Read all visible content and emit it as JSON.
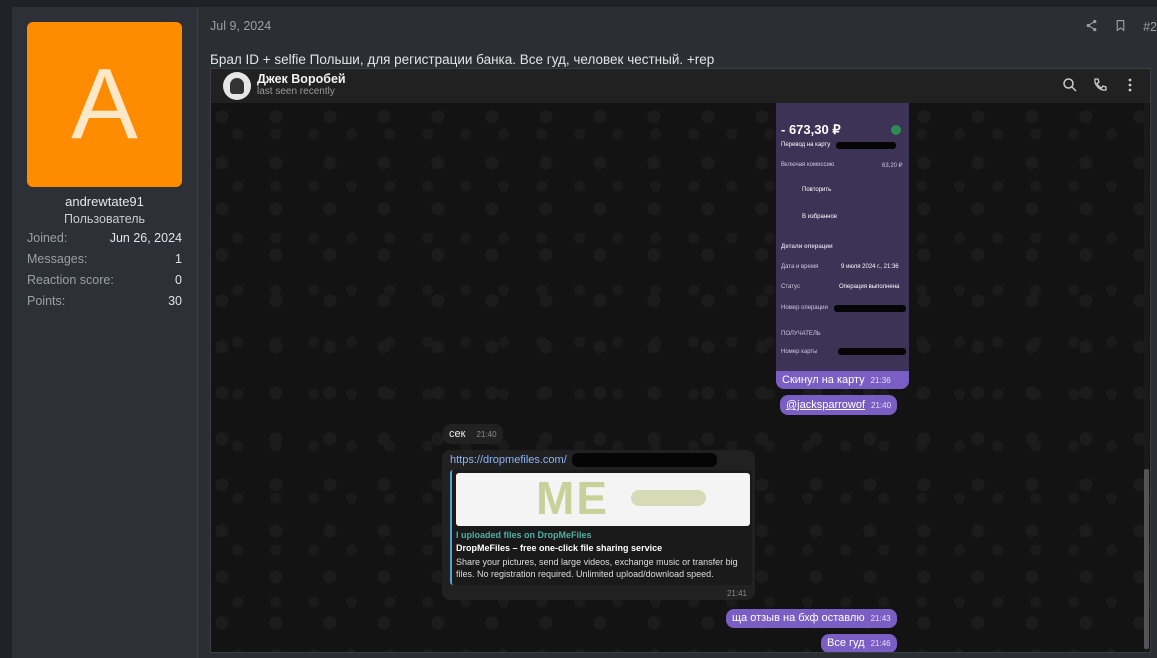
{
  "user": {
    "avatar_letter": "A",
    "username": "andrewtate91",
    "title": "Пользователь",
    "stats": [
      {
        "label": "Joined:",
        "value": "Jun 26, 2024"
      },
      {
        "label": "Messages:",
        "value": "1"
      },
      {
        "label": "Reaction score:",
        "value": "0"
      },
      {
        "label": "Points:",
        "value": "30"
      }
    ]
  },
  "post": {
    "date": "Jul 9, 2024",
    "number": "#2",
    "text": "Брал ID + selfie Польши, для регистрации банка. Все гуд, человек честный. +rep"
  },
  "telegram": {
    "contact_name": "Джек Воробей",
    "contact_status": "last seen recently",
    "bank": {
      "amount": "- 673,30 ₽",
      "transfer_label": "Перевод на карту",
      "fee_label": "Включая комиссию",
      "fee_value": "63,20 ₽",
      "repeat": "Повторить",
      "favorite": "В избранное",
      "details_title": "Детали операции",
      "date_label": "Дата и время",
      "date_value": "9 июля 2024 г., 21:36",
      "status_label": "Статус",
      "status_value": "Операция выполнена",
      "opnum_label": "Номер операции",
      "recipient_label": "ПОЛУЧАТЕЛЬ",
      "card_label": "Номер карты"
    },
    "messages": [
      {
        "text": "Скинул на карту",
        "time": "21:36"
      },
      {
        "text": "@jacksparrowof",
        "time": "21:40"
      },
      {
        "text": "сек",
        "time": "21:40"
      },
      {
        "text": "ща отзыв на бхф оставлю",
        "time": "21:43"
      },
      {
        "text": "Все гуд",
        "time": "21:46"
      }
    ],
    "link_card": {
      "url": "https://dropmefiles.com/",
      "preview_title": "I uploaded files on DropMeFiles",
      "preview_name": "DropMeFiles – free one-click file sharing service",
      "preview_desc": "Share your pictures, send large videos, exchange music or transfer big files. No registration required. Unlimited upload/download speed.",
      "logo_text": "ME",
      "time": "21:41"
    }
  },
  "icons": [
    "share-icon",
    "bookmark-icon",
    "search-icon",
    "phone-icon",
    "more-icon"
  ],
  "colors": {
    "avatar": "#ff8c00",
    "outgoing": "#7a5ec4",
    "bank_bg": "#3d3356"
  }
}
